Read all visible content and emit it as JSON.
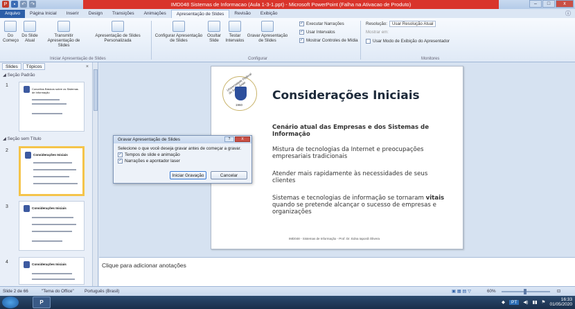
{
  "window": {
    "title": "IMD048 Sistemas de Informacao (Aula 1-3-1.ppt) - Microsoft PowerPoint (Falha na Ativacao de Produto)",
    "controls": [
      "–",
      "□",
      "x"
    ]
  },
  "ribbon_tabs": [
    "Arquivo",
    "Página Inicial",
    "Inserir",
    "Design",
    "Transições",
    "Animações",
    "Apresentação de Slides",
    "Revisão",
    "Exibição"
  ],
  "ribbon": {
    "start_group": {
      "from_start": "Do Começo",
      "from_current": "Do Slide Atual",
      "broadcast": "Transmitir Apresentação de Slides",
      "custom": "Apresentação de Slides Personalizada",
      "label": "Iniciar Apresentação de Slides"
    },
    "config_group": {
      "setup": "Configurar Apresentação de Slides",
      "hide": "Ocultar Slide",
      "rehearse": "Testar Intervalos",
      "record": "Gravar Apresentação de Slides",
      "narrations": "Executar Narrações",
      "timings": "Usar Intervalos",
      "media_controls": "Mostrar Controles de Mídia",
      "label": "Configurar"
    },
    "monitors_group": {
      "resolution_label": "Resolução:",
      "resolution_value": "Usar Resolução Atual",
      "show_on": "Mostrar em:",
      "presenter_view": "Usar Modo de Exibição do Apresentador",
      "label": "Monitores"
    }
  },
  "left_pane": {
    "tabs": [
      "Slides",
      "Tópicos"
    ],
    "sections": [
      "Seção Padrão",
      "Seção sem Título"
    ],
    "slides": [
      {
        "num": "1",
        "title": "Conceitos Básicos sobre os Sistemas de Informação"
      },
      {
        "num": "2",
        "title": "Considerações Iniciais"
      },
      {
        "num": "3",
        "title": "Considerações Iniciais"
      },
      {
        "num": "4",
        "title": "Considerações Iniciais"
      }
    ]
  },
  "slide": {
    "university_text": "Universidade Federal do Semi-Árido",
    "year": "1960",
    "title": "Considerações Iniciais",
    "subtitle": "Cenário atual das Empresas e dos Sistemas de Informação",
    "p1": "Mistura de tecnologias da Internet e preocupações empresariais tradicionais",
    "p2": "Atender mais rapidamente às necessidades de seus clientes",
    "p3_before": "Sistemas e tecnologias de informação se tornaram ",
    "p3_bold": "vitais",
    "p3_after": " quando se pretende alcançar o sucesso de empresas e organizações",
    "footer": "IMD048 - Sistemas de Informação - Prof. Dr. Edna Iaponã Olivera"
  },
  "dialog": {
    "title": "Gravar Apresentação de Slides",
    "prompt": "Selecione o que você deseja gravar antes de começar a gravar.",
    "opt1": "Tempos de slide e animação",
    "opt2": "Narrações e apontador laser",
    "start": "Iniciar Gravação",
    "cancel": "Cancelar",
    "help": "?",
    "close": "X"
  },
  "notes": {
    "placeholder": "Clique para adicionar anotações"
  },
  "statusbar": {
    "slide_info": "Slide 2 de 66",
    "theme": "\"Tema do Office\"",
    "language": "Português (Brasil)",
    "zoom": "60%"
  },
  "taskbar": {
    "app": "P",
    "lang": "PT",
    "time": "16:33",
    "date": "01/05/2020"
  }
}
